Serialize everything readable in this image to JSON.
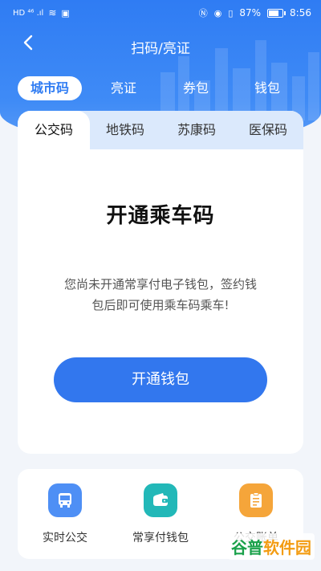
{
  "status_bar": {
    "left_text": "HD ⁴⁶ .ıl",
    "battery": "87%",
    "time": "8:56"
  },
  "nav": {
    "title": "扫码/亮证",
    "back_icon": "chevron-left-icon"
  },
  "top_tabs": [
    {
      "label": "城市码",
      "active": true
    },
    {
      "label": "亮证",
      "active": false
    },
    {
      "label": "券包",
      "active": false
    },
    {
      "label": "钱包",
      "active": false
    }
  ],
  "sub_tabs": [
    {
      "label": "公交码",
      "active": true
    },
    {
      "label": "地铁码",
      "active": false
    },
    {
      "label": "苏康码",
      "active": false
    },
    {
      "label": "医保码",
      "active": false
    }
  ],
  "card": {
    "headline": "开通乘车码",
    "description_line1": "您尚未开通常享付电子钱包，签约钱",
    "description_line2": "包后即可使用乘车码乘车!",
    "button_label": "开通钱包"
  },
  "services": [
    {
      "label": "实时公交",
      "icon": "bus-icon",
      "color": "#4e8ff5"
    },
    {
      "label": "常享付钱包",
      "icon": "wallet-icon",
      "color": "#22b8b8"
    },
    {
      "label": "公交账单",
      "icon": "clipboard-icon",
      "color": "#f5a53a"
    }
  ],
  "watermark": {
    "part1": "谷普",
    "part2": "软件园"
  },
  "colors": {
    "primary": "#2f7cf3",
    "button": "#3277ee",
    "tab_bg": "#dbe9fc"
  }
}
